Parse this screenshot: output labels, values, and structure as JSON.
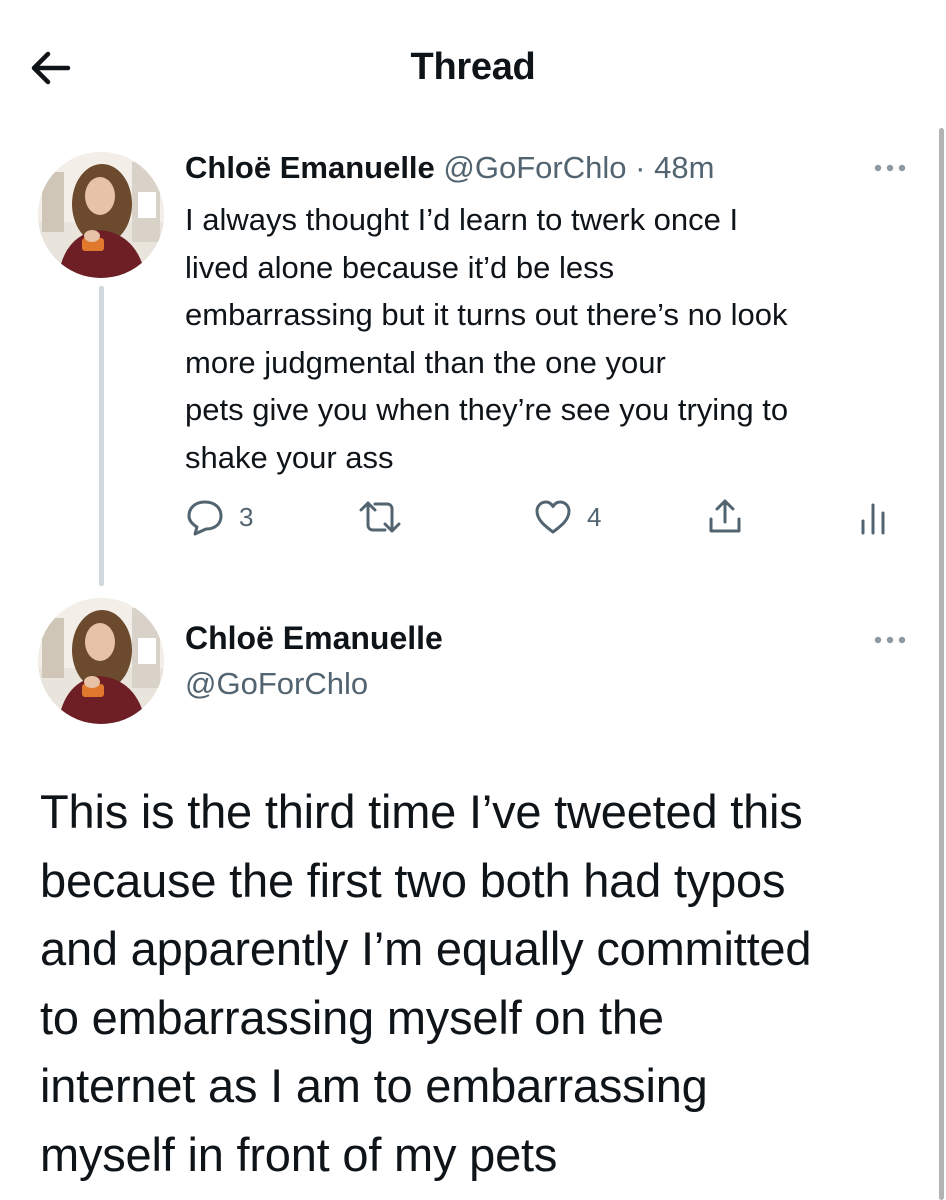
{
  "header": {
    "title": "Thread",
    "back_icon": "arrow-left-icon"
  },
  "tweets": [
    {
      "author_name": "Chloë Emanuelle",
      "handle": "@GoForChlo",
      "separator": "·",
      "time": "48m",
      "text_lines": [
        "I always thought I’d learn to twerk once I",
        "lived alone because it’d be less",
        "embarrassing but it turns out there’s no look",
        "more judgmental than the one your",
        "pets give you when they’re see you trying to",
        "shake your ass"
      ],
      "actions": {
        "reply_count": "3",
        "retweet_count": "",
        "like_count": "4"
      }
    },
    {
      "author_name": "Chloë Emanuelle",
      "handle": "@GoForChlo",
      "text_lines": [
        "This is the third time I’ve tweeted this",
        "because the first two both had typos",
        "and apparently I’m equally committed",
        "to embarrassing myself on the",
        "internet as I am to embarrassing",
        "myself in front of my pets"
      ]
    }
  ],
  "colors": {
    "text": "#0f1419",
    "muted": "#536471",
    "thread_line": "#cfd9de"
  }
}
